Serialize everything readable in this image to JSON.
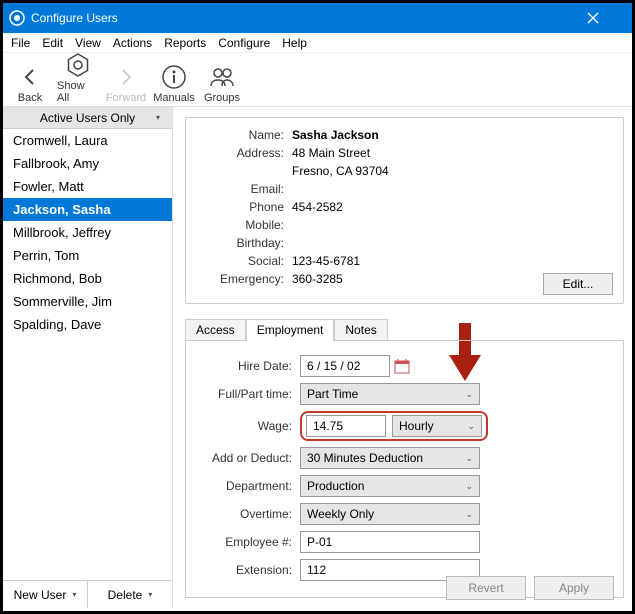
{
  "window": {
    "title": "Configure Users"
  },
  "menu": {
    "items": [
      "File",
      "Edit",
      "View",
      "Actions",
      "Reports",
      "Configure",
      "Help"
    ]
  },
  "toolbar": {
    "back": "Back",
    "show_all": "Show All",
    "forward": "Forward",
    "manuals": "Manuals",
    "groups": "Groups"
  },
  "filter": {
    "label": "Active Users Only"
  },
  "users": {
    "items": [
      "Cromwell, Laura",
      "Fallbrook, Amy",
      "Fowler, Matt",
      "Jackson, Sasha",
      "Millbrook, Jeffrey",
      "Perrin, Tom",
      "Richmond, Bob",
      "Sommerville, Jim",
      "Spalding, Dave"
    ],
    "selected_index": 3
  },
  "sidebar_footer": {
    "new_user": "New User",
    "delete": "Delete"
  },
  "summary": {
    "labels": {
      "name": "Name:",
      "address": "Address:",
      "email": "Email:",
      "phone": "Phone",
      "mobile": "Mobile:",
      "birthday": "Birthday:",
      "social": "Social:",
      "emergency": "Emergency:"
    },
    "name": "Sasha Jackson",
    "address_line1": "48 Main Street",
    "address_line2": "Fresno, CA 93704",
    "email": "",
    "phone": "454-2582",
    "mobile": "",
    "birthday": "",
    "social": "123-45-6781",
    "emergency": "360-3285",
    "edit_label": "Edit..."
  },
  "tabs": {
    "items": [
      "Access",
      "Employment",
      "Notes"
    ],
    "active_index": 1
  },
  "employment": {
    "labels": {
      "hire_date": "Hire Date:",
      "fullpart": "Full/Part time:",
      "wage": "Wage:",
      "add_deduct": "Add or Deduct:",
      "department": "Department:",
      "overtime": "Overtime:",
      "employee_no": "Employee #:",
      "extension": "Extension:"
    },
    "hire_date": "6 / 15 / 02",
    "fullpart": "Part Time",
    "wage_amount": "14.75",
    "wage_type": "Hourly",
    "add_deduct": "30 Minutes Deduction",
    "department": "Production",
    "overtime": "Weekly Only",
    "employee_no": "P-01",
    "extension": "112"
  },
  "footer": {
    "revert": "Revert",
    "apply": "Apply"
  },
  "colors": {
    "accent": "#0078d7",
    "highlight": "#c0392b"
  }
}
